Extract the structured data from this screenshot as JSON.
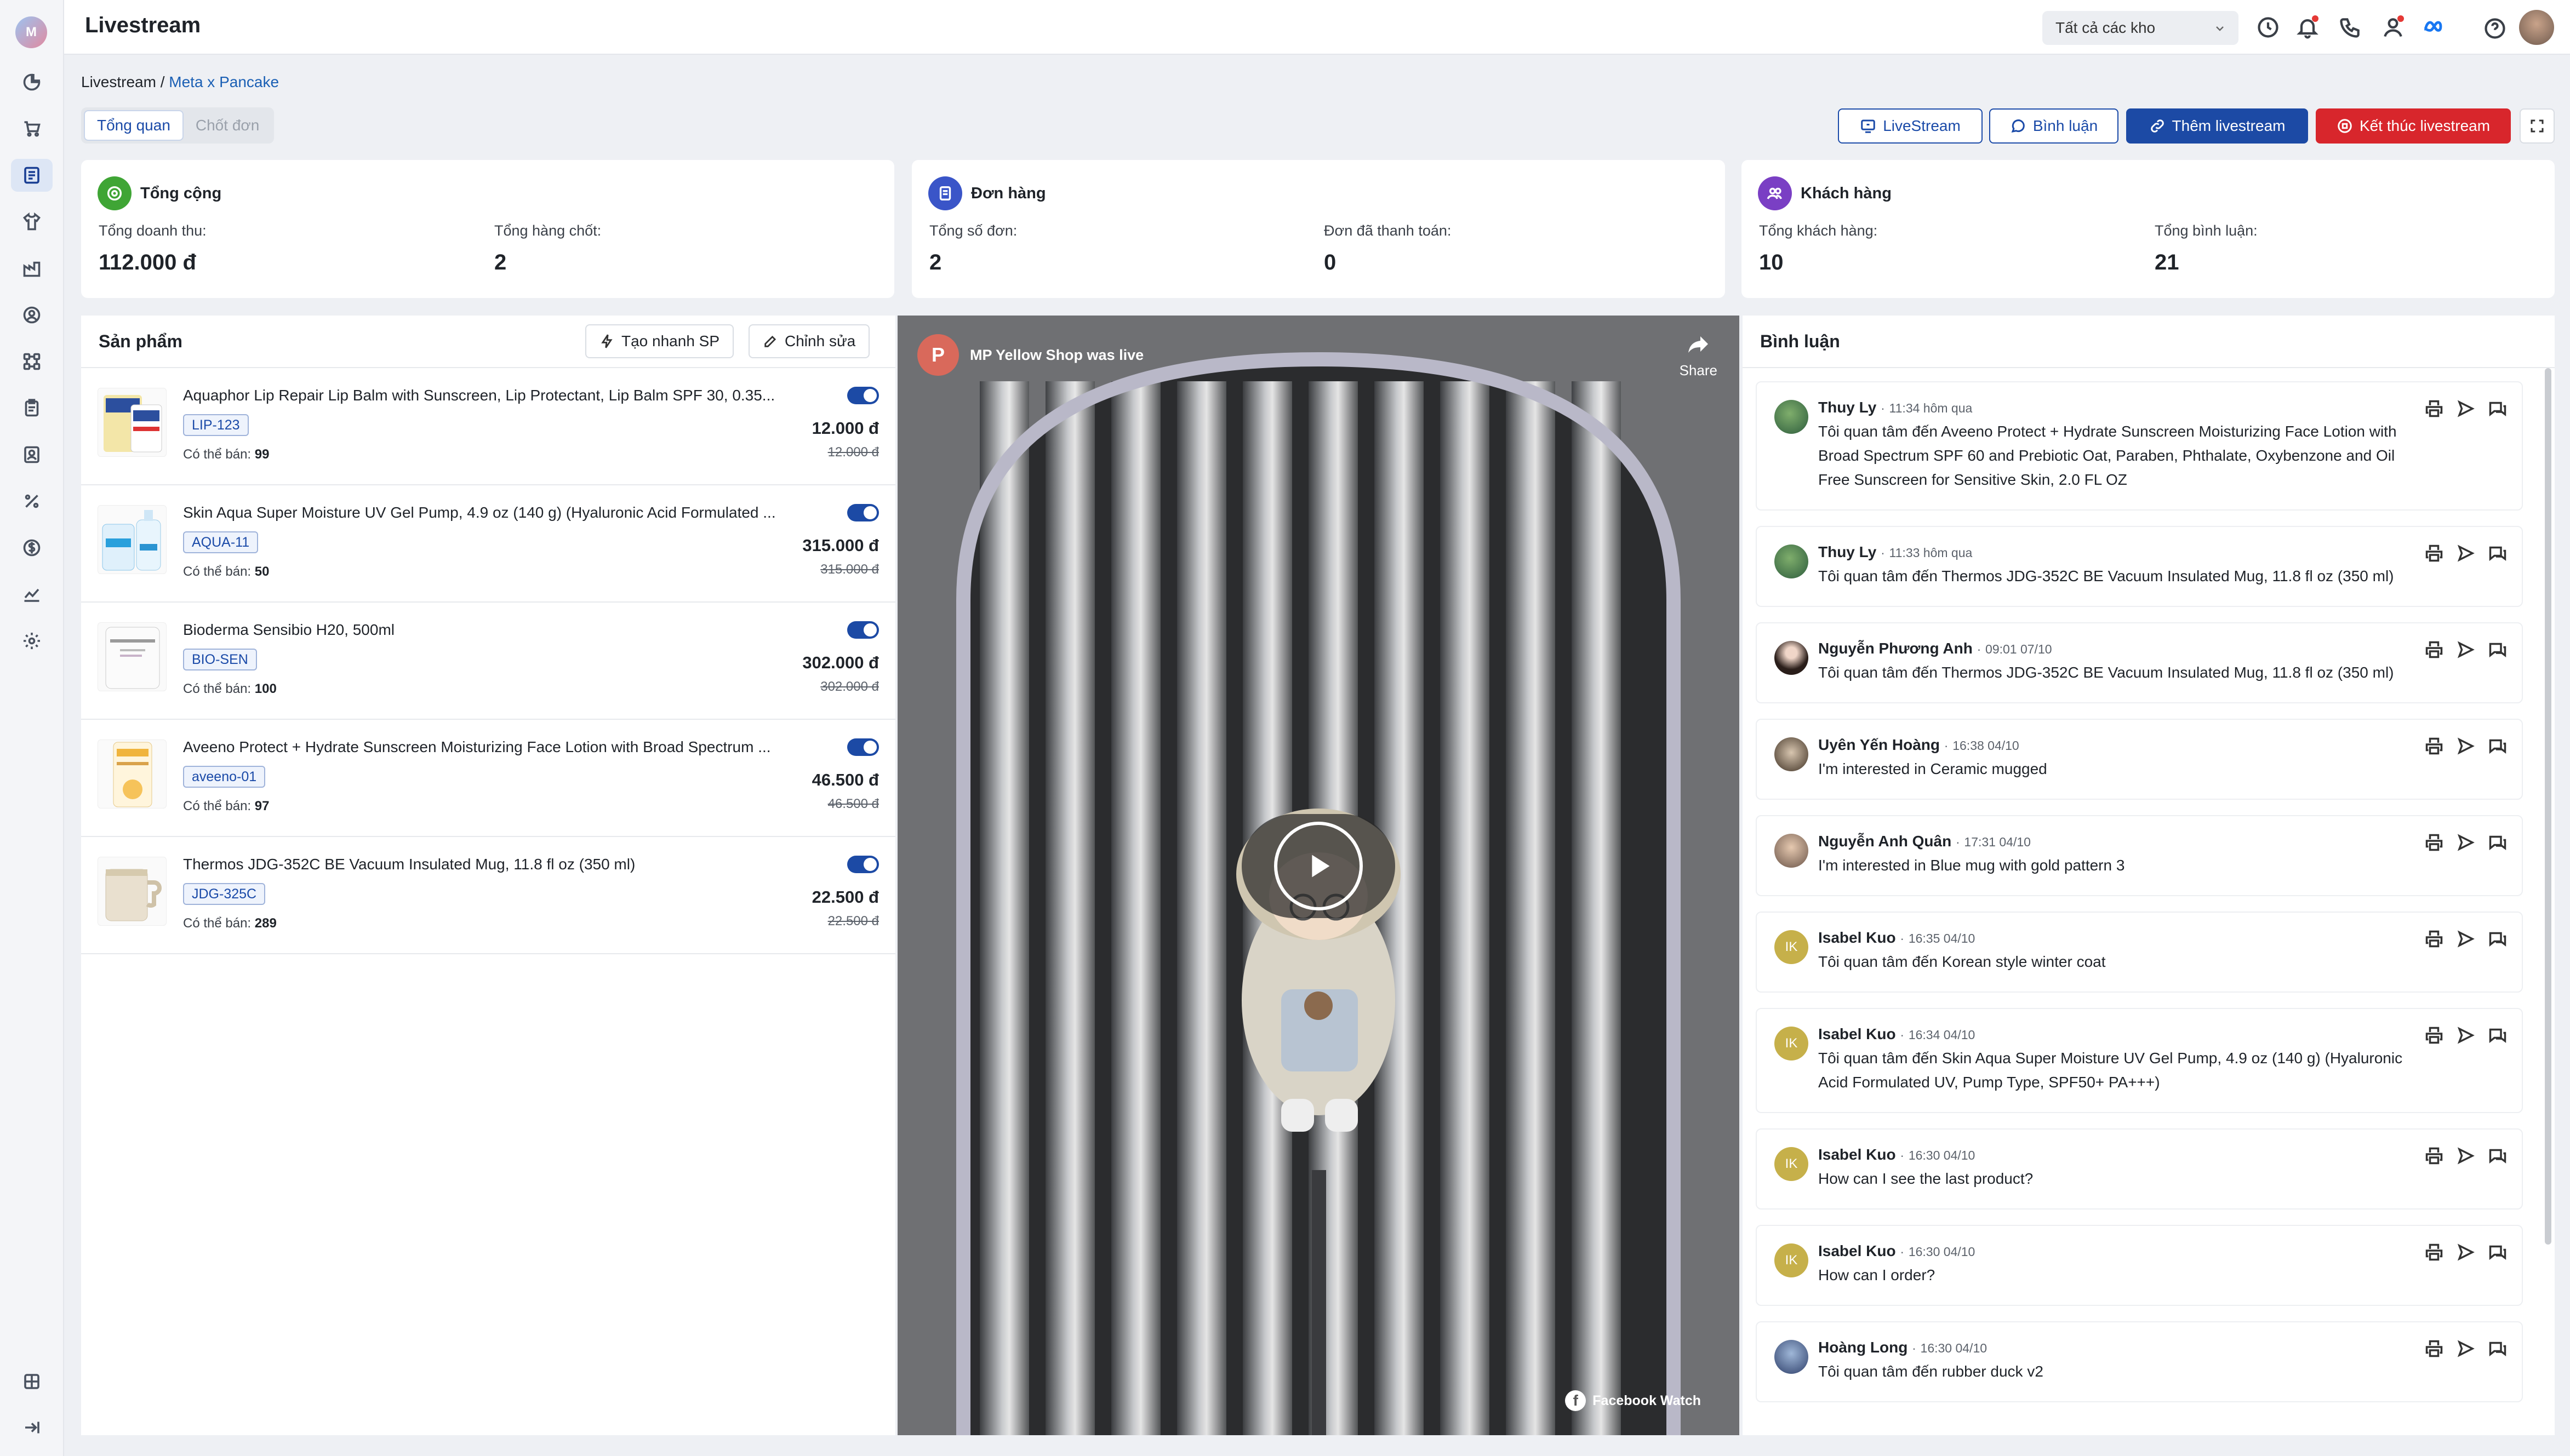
{
  "app": {
    "title": "Livestream"
  },
  "topbar": {
    "warehouse": "Tất cả các kho",
    "icons": [
      "history-icon",
      "bell-icon",
      "phone-icon",
      "user-icon",
      "meta-icon",
      "help-icon",
      "avatar"
    ]
  },
  "breadcrumb": {
    "root": "Livestream",
    "sep": "/",
    "current": "Meta x Pancake"
  },
  "tabs": [
    {
      "label": "Tổng quan",
      "active": true
    },
    {
      "label": "Chốt đơn",
      "active": false
    }
  ],
  "actions": {
    "livestream": "LiveStream",
    "comments": "Bình luận",
    "add": "Thêm livestream",
    "end": "Kết thúc livestream"
  },
  "summary": {
    "total": {
      "title": "Tổng cộng",
      "revenue_label": "Tổng doanh thu:",
      "revenue": "112.000 đ",
      "items_label": "Tổng hàng chốt:",
      "items": "2"
    },
    "orders": {
      "title": "Đơn hàng",
      "count_label": "Tổng số đơn:",
      "count": "2",
      "paid_label": "Đơn đã thanh toán:",
      "paid": "0"
    },
    "customers": {
      "title": "Khách hàng",
      "count_label": "Tổng khách hàng:",
      "count": "10",
      "comments_label": "Tổng bình luận:",
      "comments": "21"
    }
  },
  "products": {
    "title": "Sản phẩm",
    "quick_add": "Tạo nhanh SP",
    "edit": "Chỉnh sửa",
    "stock_label": "Có thể bán:",
    "items": [
      {
        "name": "Aquaphor Lip Repair Lip Balm with Sunscreen, Lip Protectant, Lip Balm SPF 30, 0.35...",
        "sku": "LIP-123",
        "stock": "99",
        "price": "12.000 đ",
        "old_price": "12.000 đ",
        "enabled": true
      },
      {
        "name": "Skin Aqua Super Moisture UV Gel Pump, 4.9 oz (140 g) (Hyaluronic Acid Formulated ...",
        "sku": "AQUA-11",
        "stock": "50",
        "price": "315.000 đ",
        "old_price": "315.000 đ",
        "enabled": true
      },
      {
        "name": "Bioderma Sensibio H20, 500ml",
        "sku": "BIO-SEN",
        "stock": "100",
        "price": "302.000 đ",
        "old_price": "302.000 đ",
        "enabled": true
      },
      {
        "name": "Aveeno Protect + Hydrate Sunscreen Moisturizing Face Lotion with Broad Spectrum ...",
        "sku": "aveeno-01",
        "stock": "97",
        "price": "46.500 đ",
        "old_price": "46.500 đ",
        "enabled": true
      },
      {
        "name": "Thermos JDG-352C BE Vacuum Insulated Mug, 11.8 fl oz (350 ml)",
        "sku": "JDG-325C",
        "stock": "289",
        "price": "22.500 đ",
        "old_price": "22.500 đ",
        "enabled": true
      }
    ]
  },
  "video": {
    "page_initial": "P",
    "caption": "MP Yellow Shop was live",
    "share": "Share",
    "watermark": "Facebook Watch"
  },
  "comments": {
    "title": "Bình luận",
    "items": [
      {
        "name": "Thuy Ly",
        "time": "11:34 hôm qua",
        "text": "Tôi quan tâm đến Aveeno Protect + Hydrate Sunscreen Moisturizing Face Lotion with Broad Spectrum SPF 60 and Prebiotic Oat, Paraben, Phthalate, Oxybenzone and Oil Free Sunscreen for Sensitive Skin, 2.0 FL OZ",
        "initials": ""
      },
      {
        "name": "Thuy Ly",
        "time": "11:33 hôm qua",
        "text": "Tôi quan tâm đến Thermos JDG-352C BE Vacuum Insulated Mug, 11.8 fl oz (350 ml)",
        "initials": ""
      },
      {
        "name": "Nguyễn Phương Anh",
        "time": "09:01 07/10",
        "text": "Tôi quan tâm đến Thermos JDG-352C BE Vacuum Insulated Mug, 11.8 fl oz (350 ml)",
        "initials": ""
      },
      {
        "name": "Uyên Yến Hoàng",
        "time": "16:38 04/10",
        "text": "I'm interested in Ceramic mugged",
        "initials": ""
      },
      {
        "name": "Nguyễn Anh Quân",
        "time": "17:31 04/10",
        "text": "I'm interested in Blue mug with gold pattern 3",
        "initials": ""
      },
      {
        "name": "Isabel Kuo",
        "time": "16:35 04/10",
        "text": "Tôi quan tâm đến Korean style winter coat",
        "initials": "IK"
      },
      {
        "name": "Isabel Kuo",
        "time": "16:34 04/10",
        "text": "Tôi quan tâm đến Skin Aqua Super Moisture UV Gel Pump, 4.9 oz (140 g) (Hyaluronic Acid Formulated UV, Pump Type, SPF50+ PA+++)",
        "initials": "IK"
      },
      {
        "name": "Isabel Kuo",
        "time": "16:30 04/10",
        "text": "How can I see the last product?",
        "initials": "IK"
      },
      {
        "name": "Isabel Kuo",
        "time": "16:30 04/10",
        "text": "How can I order?",
        "initials": "IK"
      },
      {
        "name": "Hoàng Long",
        "time": "16:30 04/10",
        "text": "Tôi quan tâm đến rubber duck v2",
        "initials": ""
      }
    ]
  },
  "colors": {
    "primary": "#1c4aa5",
    "danger": "#d8262c",
    "green": "#3fa535",
    "indigo": "#3a55c8",
    "purple": "#7a3fc4"
  }
}
